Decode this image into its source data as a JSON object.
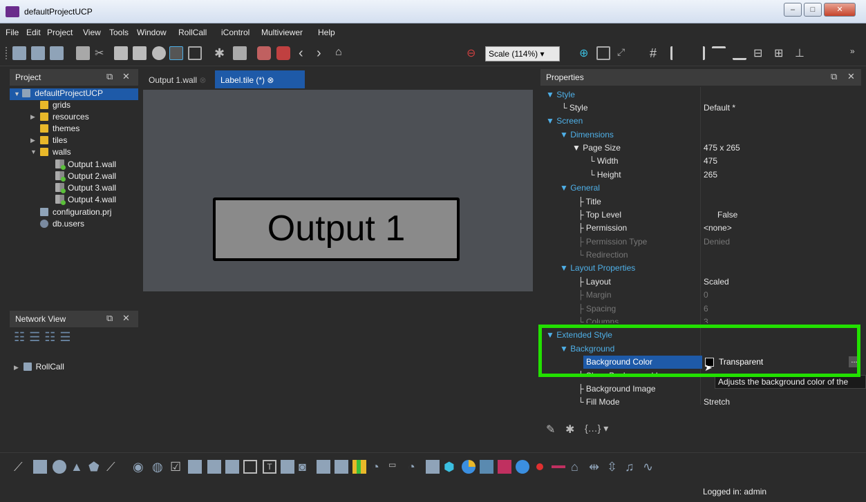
{
  "window": {
    "title": "defaultProjectUCP",
    "min": "–",
    "max": "□",
    "close": "✕"
  },
  "menu": [
    "File",
    "Edit",
    "Project",
    "View",
    "Tools",
    "Window",
    "RollCall",
    "iControl",
    "Multiviewer",
    "Help"
  ],
  "toolbar": {
    "scale": "Scale (114%)",
    "more": "»"
  },
  "project_panel": {
    "title": "Project",
    "root": "defaultProjectUCP",
    "items": [
      "grids",
      "resources",
      "themes",
      "tiles",
      "walls"
    ],
    "walls": [
      "Output 1.wall",
      "Output 2.wall",
      "Output 3.wall",
      "Output 4.wall"
    ],
    "files": [
      "configuration.prj",
      "db.users"
    ]
  },
  "network_panel": {
    "title": "Network View",
    "items": [
      "RollCall"
    ]
  },
  "tabs": [
    {
      "label": "Output 1.wall"
    },
    {
      "label": "Label.tile (*)"
    }
  ],
  "canvas": {
    "label_text": "Output 1"
  },
  "properties": {
    "title": "Properties",
    "rows": [
      {
        "key": "Style",
        "value": ""
      },
      {
        "key": "Style",
        "value": "Default *"
      },
      {
        "key": "Screen",
        "value": ""
      },
      {
        "key": "Dimensions",
        "value": ""
      },
      {
        "key": "Page Size",
        "value": "475 x 265"
      },
      {
        "key": "Width",
        "value": "475"
      },
      {
        "key": "Height",
        "value": "265"
      },
      {
        "key": "General",
        "value": ""
      },
      {
        "key": "Title",
        "value": ""
      },
      {
        "key": "Top Level",
        "value": "False"
      },
      {
        "key": "Permission",
        "value": "<none>"
      },
      {
        "key": "Permission Type",
        "value": "Denied"
      },
      {
        "key": "Redirection",
        "value": ""
      },
      {
        "key": "Layout Properties",
        "value": ""
      },
      {
        "key": "Layout",
        "value": "Scaled"
      },
      {
        "key": "Margin",
        "value": "0"
      },
      {
        "key": "Spacing",
        "value": "6"
      },
      {
        "key": "Columns",
        "value": "3"
      },
      {
        "key": "Extended Style",
        "value": ""
      },
      {
        "key": "Background",
        "value": ""
      },
      {
        "key": "Background Color",
        "value": "Transparent"
      },
      {
        "key": "Show Background Image",
        "value": ""
      },
      {
        "key": "Background Image",
        "value": ""
      },
      {
        "key": "Fill Mode",
        "value": "Stretch"
      }
    ],
    "ellipsis": "...",
    "tooltip": "Adjusts the background color of the"
  },
  "status": {
    "login": "Logged in: admin"
  },
  "colors": {
    "highlight": "#22e000",
    "selection": "#1e5aa8",
    "accent": "#4fb0e8"
  }
}
